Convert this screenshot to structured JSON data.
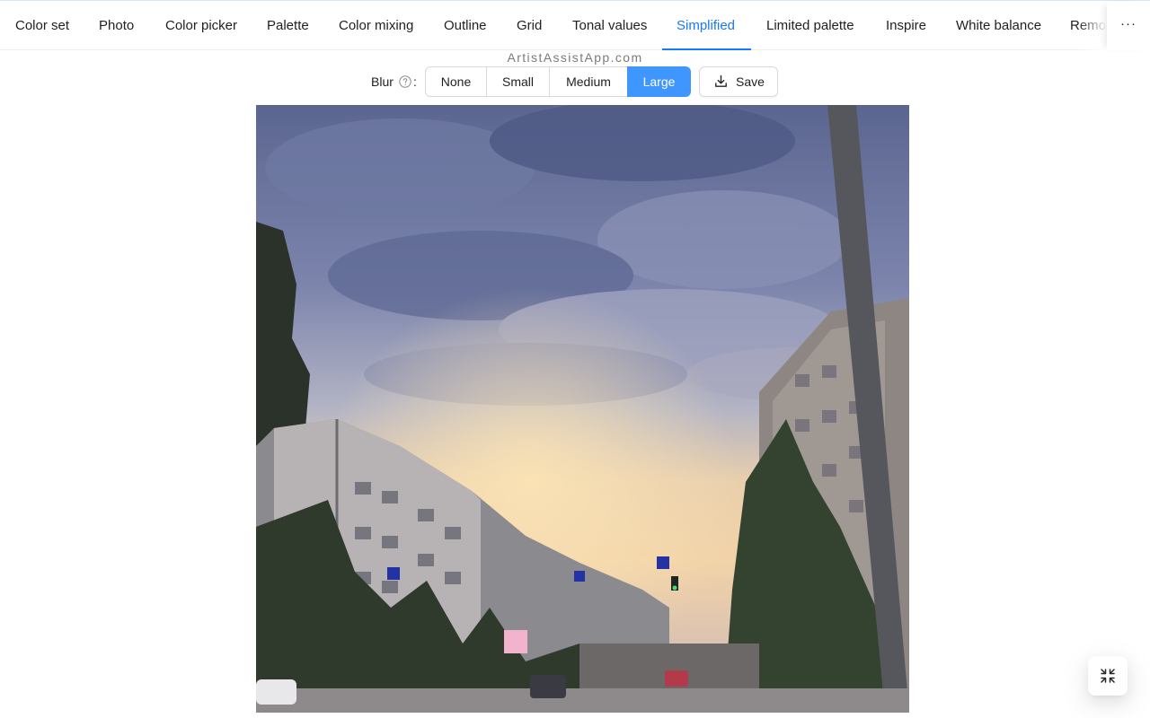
{
  "tabs": [
    {
      "label": "Color set"
    },
    {
      "label": "Photo"
    },
    {
      "label": "Color picker"
    },
    {
      "label": "Palette"
    },
    {
      "label": "Color mixing"
    },
    {
      "label": "Outline"
    },
    {
      "label": "Grid"
    },
    {
      "label": "Tonal values"
    },
    {
      "label": "Simplified",
      "active": true
    },
    {
      "label": "Limited palette"
    },
    {
      "label": "Inspire"
    },
    {
      "label": "White balance"
    },
    {
      "label": "Remov"
    }
  ],
  "more_label": "···",
  "watermark": "ArtistAssistApp.com",
  "blur": {
    "label": "Blur",
    "colon": ":",
    "options": [
      "None",
      "Small",
      "Medium",
      "Large"
    ],
    "selected": "Large"
  },
  "save_label": "Save",
  "colors": {
    "accent": "#1677ff",
    "selected_segment": "#4096ff"
  },
  "icons": {
    "help": "question-circle-icon",
    "save": "download-icon",
    "fullscreen": "fullscreen-exit-icon"
  }
}
